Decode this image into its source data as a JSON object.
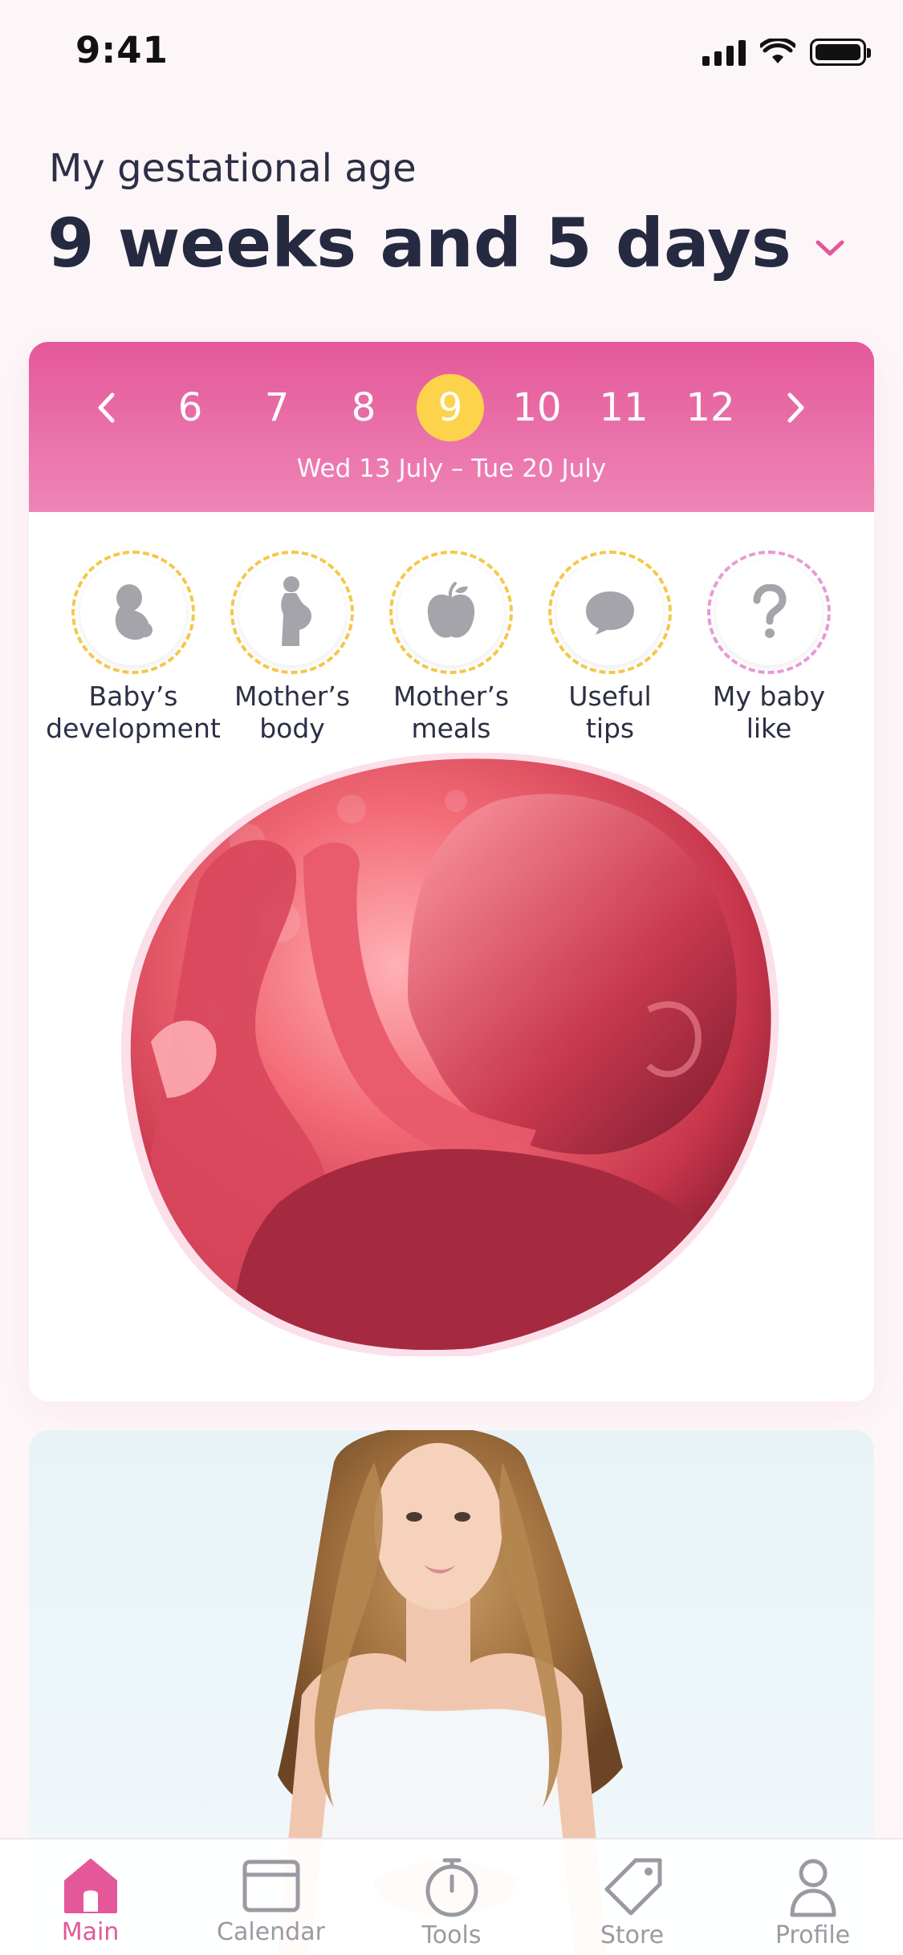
{
  "status_bar": {
    "time": "9:41"
  },
  "header": {
    "label": "My gestational age",
    "value": "9 weeks and 5 days"
  },
  "week_selector": {
    "weeks": [
      "6",
      "7",
      "8",
      "9",
      "10",
      "11",
      "12"
    ],
    "selected": "9",
    "range": "Wed 13 July – Tue 20 July"
  },
  "categories": [
    {
      "label": "Baby’s\ndevelopment",
      "icon": "fetus-icon"
    },
    {
      "label": "Mother’s\nbody",
      "icon": "pregnant-woman-icon"
    },
    {
      "label": "Mother’s\nmeals",
      "icon": "apple-icon"
    },
    {
      "label": "Useful\ntips",
      "icon": "speech-bubble-icon"
    },
    {
      "label": "My baby\nlike",
      "icon": "question-mark-icon"
    }
  ],
  "tabbar": {
    "items": [
      {
        "label": "Main",
        "icon": "home-icon"
      },
      {
        "label": "Calendar",
        "icon": "calendar-icon"
      },
      {
        "label": "Tools",
        "icon": "stopwatch-icon"
      },
      {
        "label": "Store",
        "icon": "tag-icon"
      },
      {
        "label": "Profile",
        "icon": "person-icon"
      }
    ],
    "active": "Main"
  },
  "colors": {
    "accent_pink": "#e4589a",
    "selected_week": "#fcd34b",
    "ring_yellow": "#f5c84a",
    "ring_pink": "#e89ad6"
  }
}
